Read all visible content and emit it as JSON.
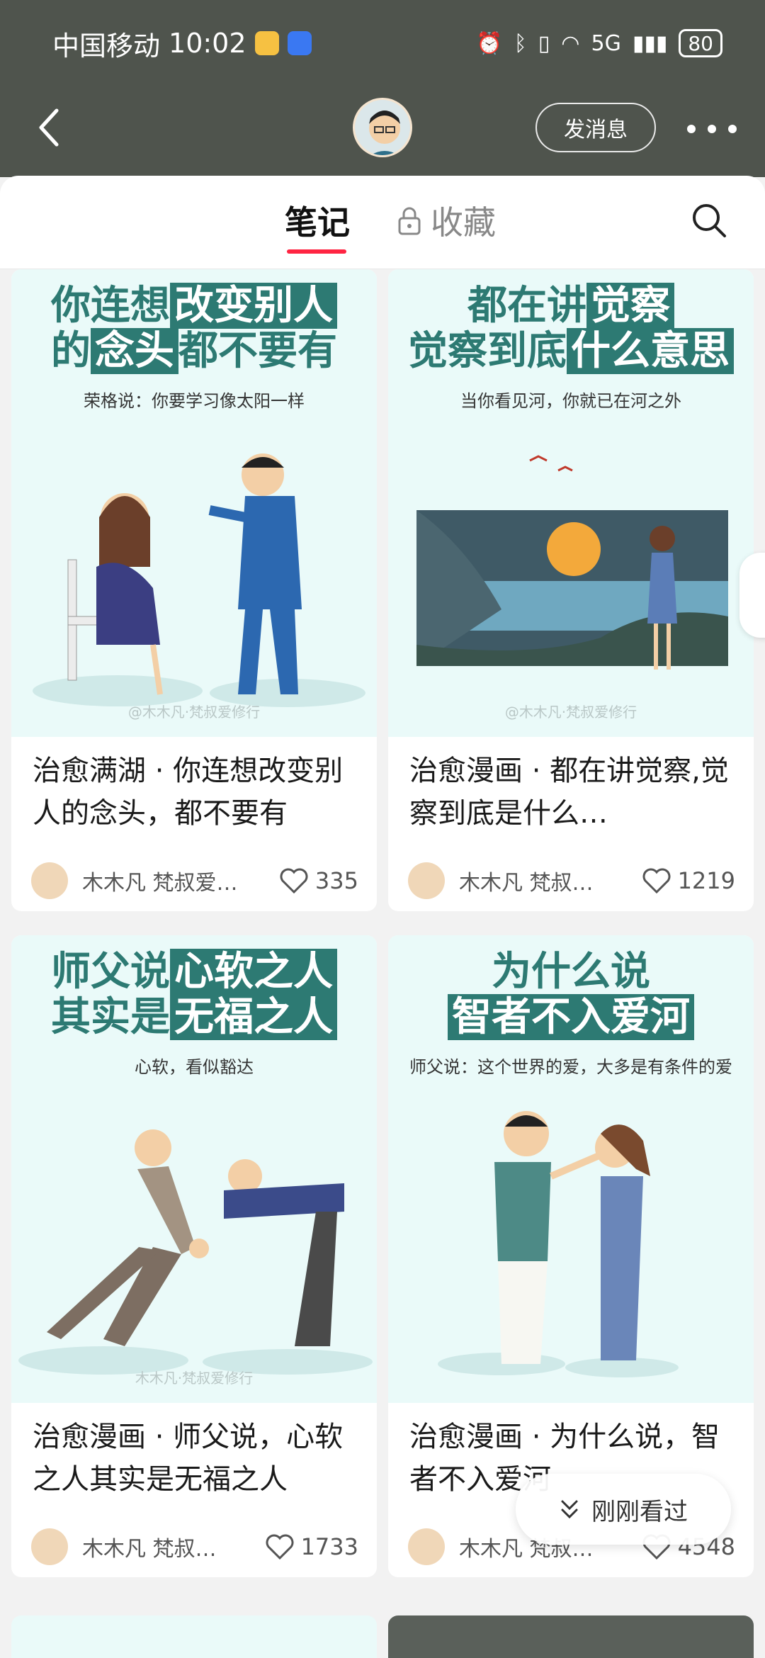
{
  "status_bar": {
    "carrier": "中国移动",
    "time": "10:02",
    "network": "5G",
    "battery": "80"
  },
  "header": {
    "message_button": "发消息"
  },
  "tabs": {
    "notes": "笔记",
    "collections": "收藏"
  },
  "cards": [
    {
      "headline_plain_1": "你连想",
      "headline_hl_1": "改变别人",
      "headline_plain_2a": "的",
      "headline_hl_2": "念头",
      "headline_plain_2b": "都不要有",
      "subtitle": "荣格说：你要学习像太阳一样",
      "watermark": "@木木凡·梵叔爱修行",
      "title": "治愈满湖 · 你连想改变别人的念头，都不要有",
      "author": "木木凡 梵叔爱…",
      "likes": "335"
    },
    {
      "headline_plain_1": "都在讲",
      "headline_hl_1": "觉察",
      "headline_plain_2a": "觉察到底",
      "headline_hl_2": "什么意思",
      "headline_plain_2b": "",
      "subtitle": "当你看见河，你就已在河之外",
      "watermark": "@木木凡·梵叔爱修行",
      "title": "治愈漫画 · 都在讲觉察,觉察到底是什么…",
      "author": "木木凡 梵叔…",
      "likes": "1219"
    },
    {
      "headline_plain_1": "师父说",
      "headline_hl_1": "心软之人",
      "headline_plain_2a": "其实是",
      "headline_hl_2": "无福之人",
      "headline_plain_2b": "",
      "subtitle": "心软，看似豁达",
      "watermark": "木木凡·梵叔爱修行",
      "title": "治愈漫画 · 师父说，心软之人其实是无福之人",
      "author": "木木凡 梵叔…",
      "likes": "1733"
    },
    {
      "headline_plain_1": "为什么说",
      "headline_hl_1": "",
      "headline_plain_2a": "",
      "headline_hl_2": "智者不入爱河",
      "headline_plain_2b": "",
      "subtitle": "师父说：这个世界的爱，大多是有条件的爱",
      "watermark": "",
      "title": "治愈漫画 · 为什么说，智者不入爱河",
      "author": "木木凡 梵叔…",
      "likes": "4548"
    }
  ],
  "recent_pill": {
    "label": "刚刚看过"
  },
  "colors": {
    "header_bg": "#4f544d",
    "accent": "#ff2442",
    "cover_teal": "#2d7a73",
    "cover_bg": "#eafaf9"
  }
}
